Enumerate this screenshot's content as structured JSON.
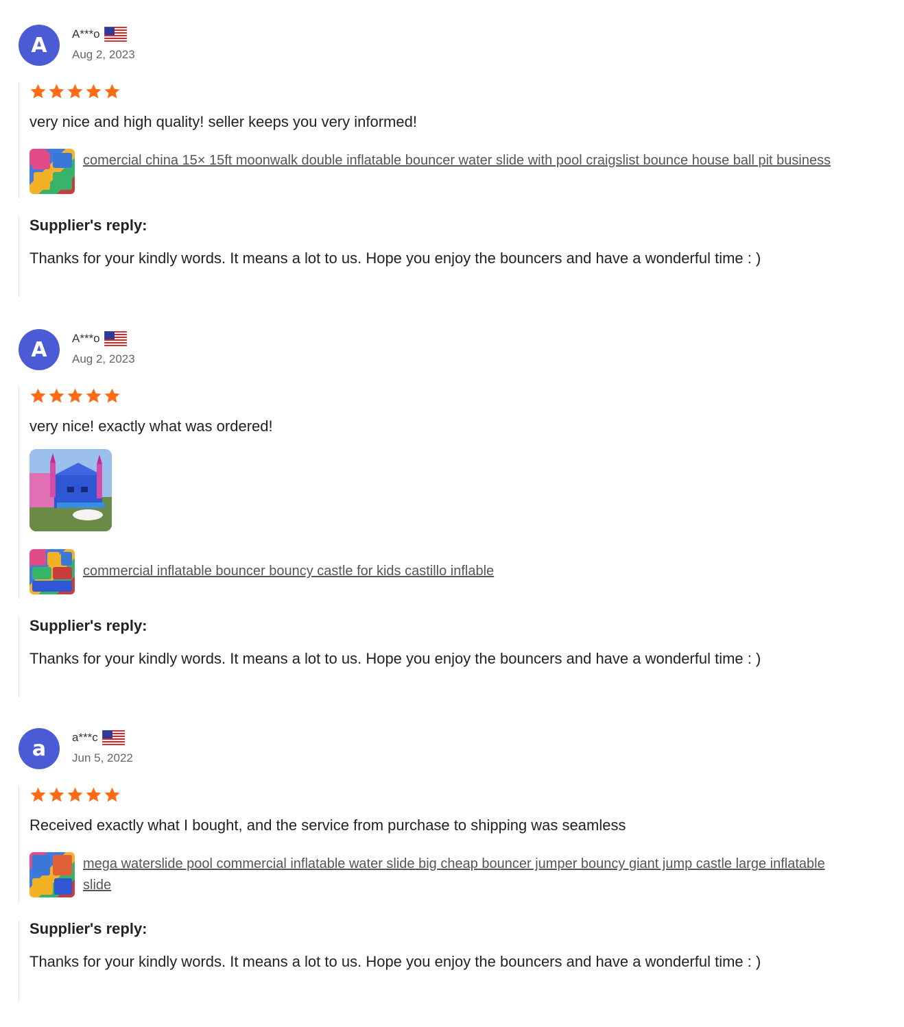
{
  "reviews": [
    {
      "initial": "A",
      "username": "A***o",
      "country_flag_icon": "us-flag-icon",
      "date": "Aug 2, 2023",
      "rating": 5,
      "text": "very nice and high quality! seller keeps you very informed!",
      "has_photo": false,
      "product_name": "comercial china 15× 15ft moonwalk double inflatable bouncer water slide with pool craigslist bounce house ball pit business",
      "reply_title": "Supplier's reply:",
      "reply_text": "Thanks for your kindly words. It means a lot to us. Hope you enjoy the bouncers and have a wonderful time : )"
    },
    {
      "initial": "A",
      "username": "A***o",
      "country_flag_icon": "us-flag-icon",
      "date": "Aug 2, 2023",
      "rating": 5,
      "text": "very nice! exactly what was ordered!",
      "has_photo": true,
      "product_name": "commercial inflatable bouncer bouncy castle for kids castillo inflable",
      "reply_title": "Supplier's reply:",
      "reply_text": "Thanks for your kindly words. It means a lot to us. Hope you enjoy the bouncers and have a wonderful time : )"
    },
    {
      "initial": "a",
      "username": "a***c",
      "country_flag_icon": "us-flag-icon",
      "date": "Jun 5, 2022",
      "rating": 5,
      "text": "Received exactly what I bought, and the service from purchase to shipping was seamless",
      "has_photo": false,
      "product_name": "mega waterslide pool commercial inflatable water slide big cheap bouncer jumper bouncy giant jump castle large inflatable slide",
      "reply_title": "Supplier's reply:",
      "reply_text": "Thanks for your kindly words. It means a lot to us. Hope you enjoy the bouncers and have a wonderful time : )"
    }
  ],
  "colors": {
    "avatar": "#4b5bd6",
    "star": "#ff6a14",
    "link": "#555555"
  }
}
